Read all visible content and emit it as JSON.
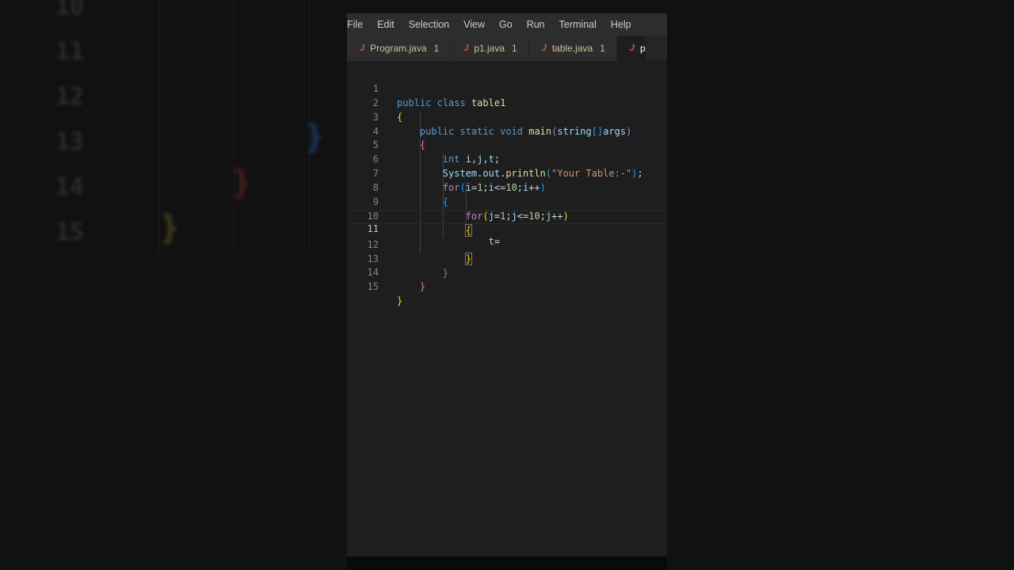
{
  "menu": [
    "File",
    "Edit",
    "Selection",
    "View",
    "Go",
    "Run",
    "Terminal",
    "Help"
  ],
  "tabs": [
    {
      "icon": "J",
      "label": "Program.java",
      "problems": "1"
    },
    {
      "icon": "J",
      "label": "p1.java",
      "problems": "1"
    },
    {
      "icon": "J",
      "label": "table.java",
      "problems": "1"
    },
    {
      "icon": "J",
      "label": "p",
      "problems": ""
    }
  ],
  "code_lines": [
    {
      "num": "1",
      "text": "public class table1"
    },
    {
      "num": "2",
      "text": "{"
    },
    {
      "num": "3",
      "text": "    public static void main(string[]args)"
    },
    {
      "num": "4",
      "text": "    {"
    },
    {
      "num": "5",
      "text": "        int i,j,t;"
    },
    {
      "num": "6",
      "text": "        System.out.println(\"Your Table:-\");"
    },
    {
      "num": "7",
      "text": "        for(i=1;i<=10;i++)"
    },
    {
      "num": "8",
      "text": "        {"
    },
    {
      "num": "9",
      "text": "            for(j=1;j<=10;j++)"
    },
    {
      "num": "10",
      "text": "            {"
    },
    {
      "num": "11",
      "text": "                t="
    },
    {
      "num": "12",
      "text": "            }"
    },
    {
      "num": "13",
      "text": "        }"
    },
    {
      "num": "14",
      "text": "    }"
    },
    {
      "num": "15",
      "text": "}"
    }
  ],
  "current_line": "11",
  "background_line_numbers": [
    "10",
    "11",
    "12",
    "13",
    "14",
    "15"
  ],
  "colors": {
    "editor_bg": "#1e1e1e",
    "keyword": "#569cd6",
    "function": "#dcdcaa",
    "string": "#ce9178",
    "tab_text": "#c9c29a",
    "java_icon": "#e0533a"
  }
}
